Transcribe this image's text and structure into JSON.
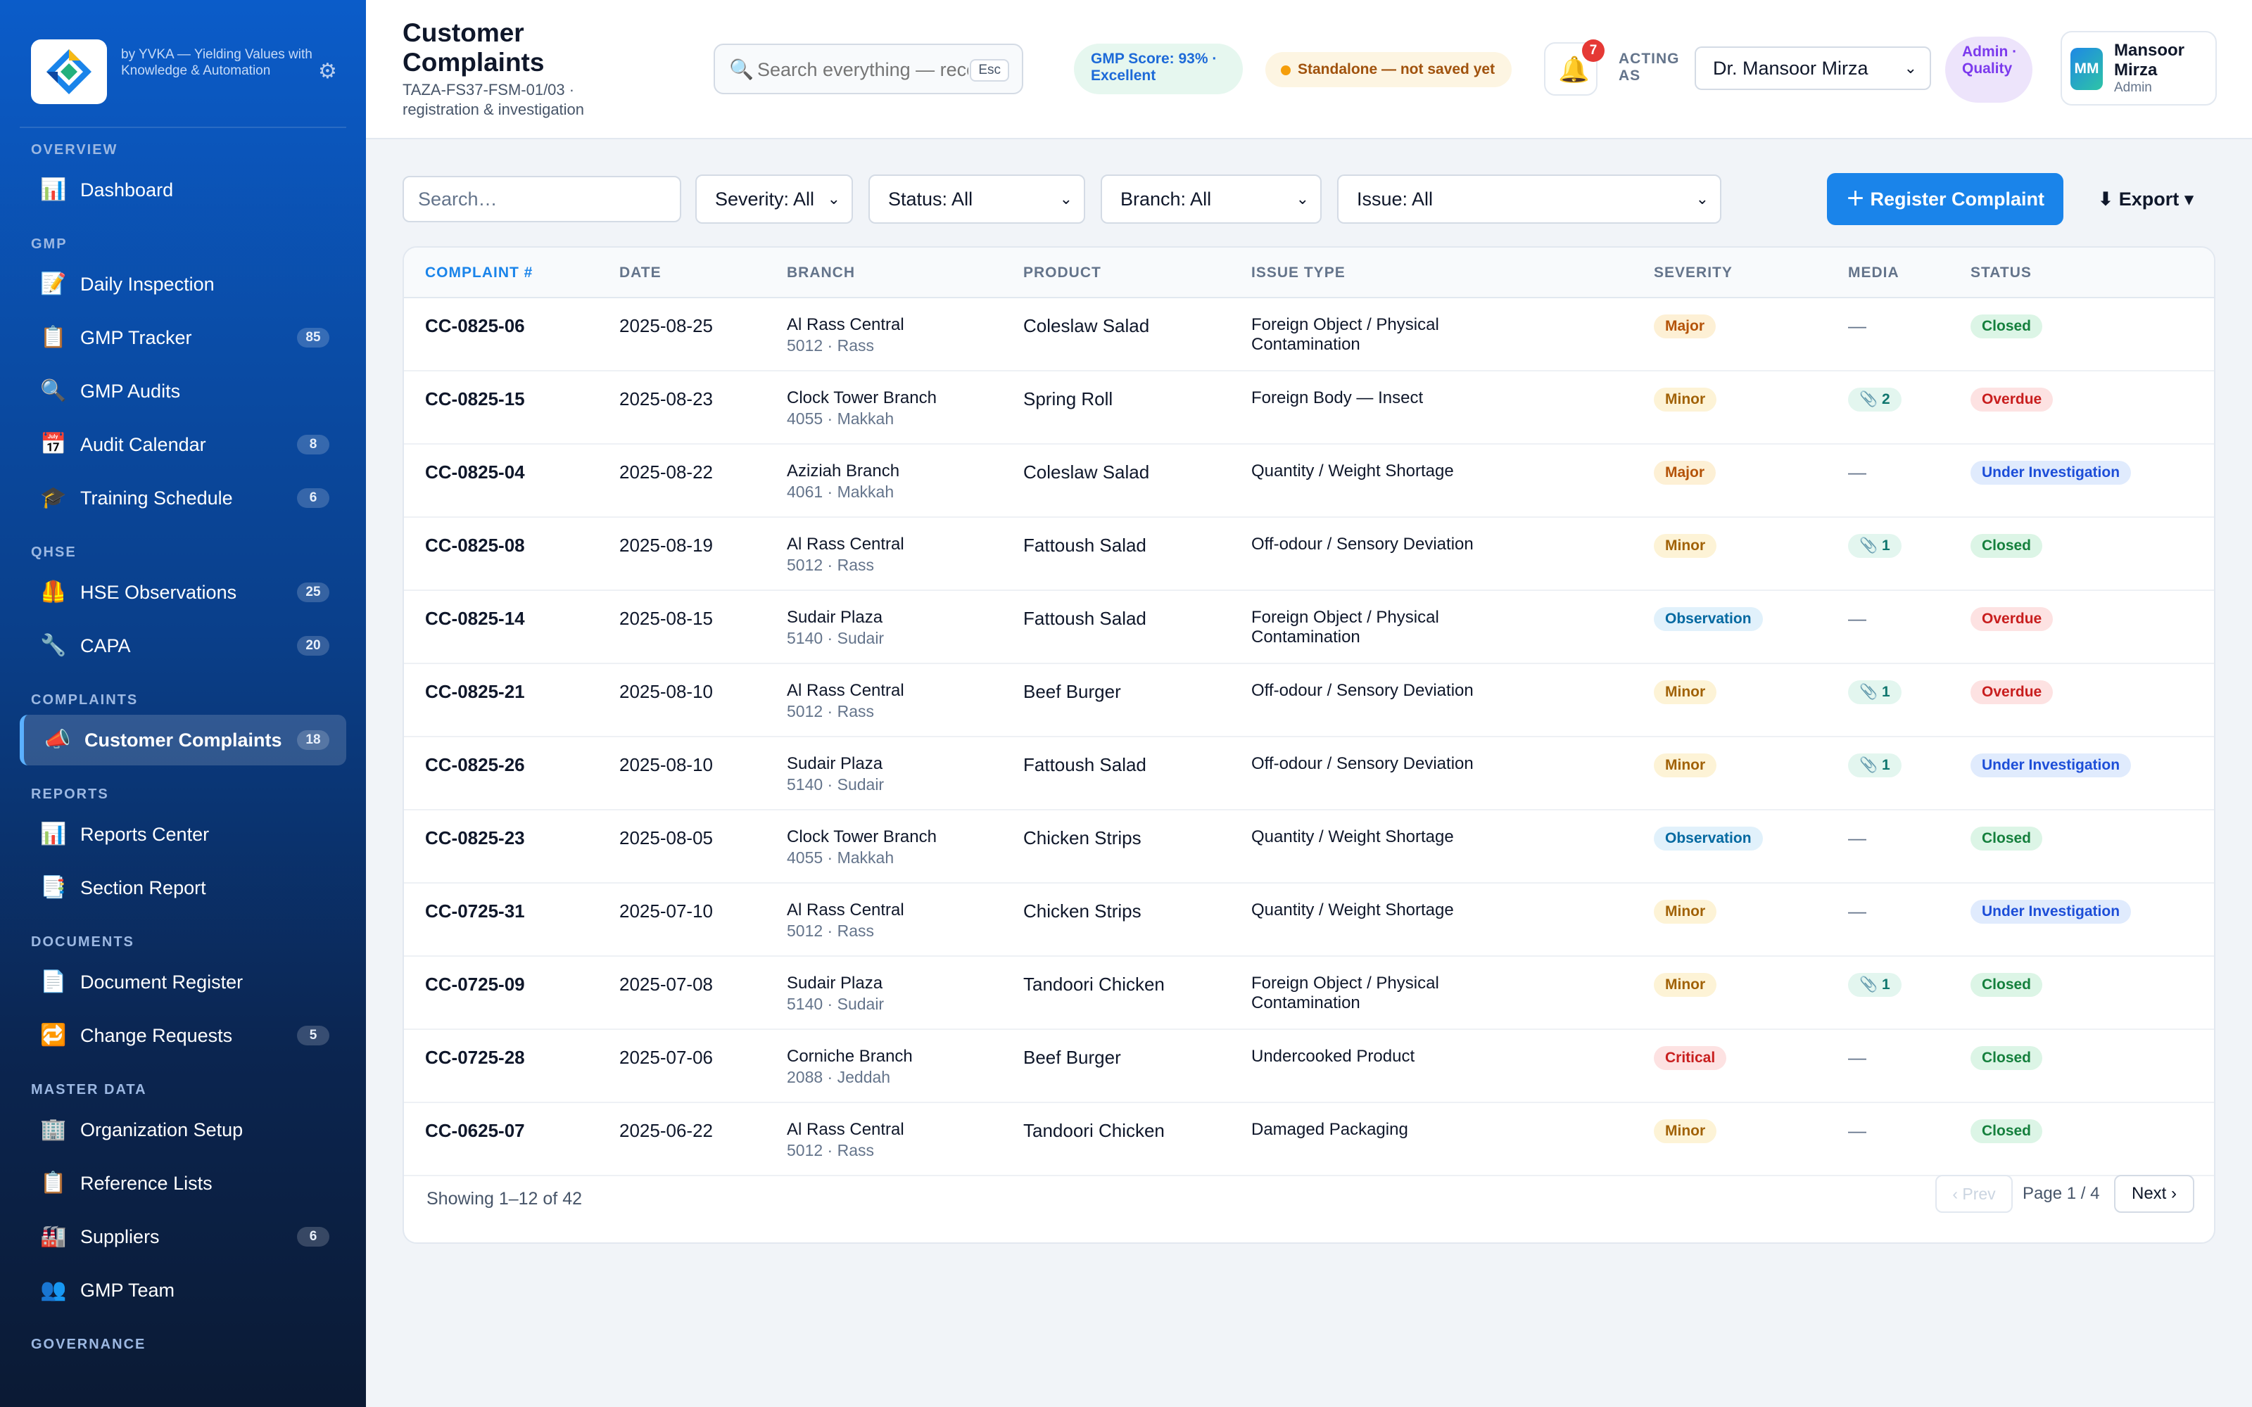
{
  "brand": {
    "tagline": "by YVKA — Yielding Values with Knowledge & Automation",
    "colors": {
      "primary": "#1a84ea",
      "sidebar": "#0b5cc9"
    }
  },
  "sidebar": {
    "sections": [
      {
        "title": "OVERVIEW",
        "items": [
          {
            "icon": "chart-icon",
            "glyph": "📊",
            "label": "Dashboard",
            "badge": ""
          }
        ]
      },
      {
        "title": "GMP",
        "items": [
          {
            "icon": "inspection-icon",
            "glyph": "📝",
            "label": "Daily Inspection",
            "badge": ""
          },
          {
            "icon": "clipboard-icon",
            "glyph": "📋",
            "label": "GMP Tracker",
            "badge": "85"
          },
          {
            "icon": "magnifier-icon",
            "glyph": "🔍",
            "label": "GMP Audits",
            "badge": ""
          },
          {
            "icon": "calendar-icon",
            "glyph": "📅",
            "label": "Audit Calendar",
            "badge": "8"
          },
          {
            "icon": "graduation-cap-icon",
            "glyph": "🎓",
            "label": "Training Schedule",
            "badge": "6"
          }
        ]
      },
      {
        "title": "QHSE",
        "items": [
          {
            "icon": "safety-vest-icon",
            "glyph": "🦺",
            "label": "HSE Observations",
            "badge": "25"
          },
          {
            "icon": "wrench-icon",
            "glyph": "🔧",
            "label": "CAPA",
            "badge": "20"
          }
        ]
      },
      {
        "title": "COMPLAINTS",
        "items": [
          {
            "icon": "megaphone-icon",
            "glyph": "📣",
            "label": "Customer Complaints",
            "badge": "18",
            "active": true
          }
        ]
      },
      {
        "title": "REPORTS",
        "items": [
          {
            "icon": "chart-icon",
            "glyph": "📊",
            "label": "Reports Center",
            "badge": ""
          },
          {
            "icon": "report-icon",
            "glyph": "📑",
            "label": "Section Report",
            "badge": ""
          }
        ]
      },
      {
        "title": "DOCUMENTS",
        "items": [
          {
            "icon": "document-icon",
            "glyph": "📄",
            "label": "Document Register",
            "badge": ""
          },
          {
            "icon": "cycle-icon",
            "glyph": "🔁",
            "label": "Change Requests",
            "badge": "5"
          }
        ]
      },
      {
        "title": "MASTER DATA",
        "items": [
          {
            "icon": "building-icon",
            "glyph": "🏢",
            "label": "Organization Setup",
            "badge": ""
          },
          {
            "icon": "clipboard-icon",
            "glyph": "📋",
            "label": "Reference Lists",
            "badge": ""
          },
          {
            "icon": "factory-icon",
            "glyph": "🏭",
            "label": "Suppliers",
            "badge": "6"
          },
          {
            "icon": "team-icon",
            "glyph": "👥",
            "label": "GMP Team",
            "badge": ""
          }
        ]
      },
      {
        "title": "GOVERNANCE",
        "items": []
      }
    ]
  },
  "header": {
    "title": "Customer Complaints",
    "subtitle": "TAZA-FS37-FSM-01/03 · registration & investigation",
    "search_placeholder": "Search everything — records, SOPs, branches…",
    "search_shortcut": "Esc",
    "gmp_score": "GMP Score: 93% · Excellent",
    "standalone_status": "Standalone — not saved yet",
    "notification_count": "7",
    "acting_as_label": "ACTING AS",
    "acting_as_value": "Dr. Mansoor Mirza",
    "role_badge": "Admin · Quality",
    "user": {
      "initials": "MM",
      "name": "Mansoor Mirza",
      "role": "Admin"
    }
  },
  "toolbar": {
    "search_placeholder": "Search…",
    "filters": [
      "Severity: All",
      "Status: All",
      "Branch: All",
      "Issue: All"
    ],
    "register_label": "＋ Register Complaint",
    "export_label": "⬇ Export ▾"
  },
  "table": {
    "columns": [
      "COMPLAINT #",
      "DATE",
      "BRANCH",
      "PRODUCT",
      "ISSUE TYPE",
      "SEVERITY",
      "MEDIA",
      "STATUS"
    ],
    "rows": [
      {
        "id": "CC-0825-06",
        "date": "2025-08-25",
        "branch": "Al Rass Central",
        "branch_sub": "5012 · Rass",
        "product": "Coleslaw Salad",
        "issue": "Foreign Object / Physical Contamination",
        "severity": "Major",
        "media": "—",
        "status": "Closed"
      },
      {
        "id": "CC-0825-15",
        "date": "2025-08-23",
        "branch": "Clock Tower Branch",
        "branch_sub": "4055 · Makkah",
        "product": "Spring Roll",
        "issue": "Foreign Body — Insect",
        "severity": "Minor",
        "media": "📎 2",
        "status": "Overdue"
      },
      {
        "id": "CC-0825-04",
        "date": "2025-08-22",
        "branch": "Aziziah Branch",
        "branch_sub": "4061 · Makkah",
        "product": "Coleslaw Salad",
        "issue": "Quantity / Weight Shortage",
        "severity": "Major",
        "media": "—",
        "status": "Under Investigation"
      },
      {
        "id": "CC-0825-08",
        "date": "2025-08-19",
        "branch": "Al Rass Central",
        "branch_sub": "5012 · Rass",
        "product": "Fattoush Salad",
        "issue": "Off-odour / Sensory Deviation",
        "severity": "Minor",
        "media": "📎 1",
        "status": "Closed"
      },
      {
        "id": "CC-0825-14",
        "date": "2025-08-15",
        "branch": "Sudair Plaza",
        "branch_sub": "5140 · Sudair",
        "product": "Fattoush Salad",
        "issue": "Foreign Object / Physical Contamination",
        "severity": "Observation",
        "media": "—",
        "status": "Overdue"
      },
      {
        "id": "CC-0825-21",
        "date": "2025-08-10",
        "branch": "Al Rass Central",
        "branch_sub": "5012 · Rass",
        "product": "Beef Burger",
        "issue": "Off-odour / Sensory Deviation",
        "severity": "Minor",
        "media": "📎 1",
        "status": "Overdue"
      },
      {
        "id": "CC-0825-26",
        "date": "2025-08-10",
        "branch": "Sudair Plaza",
        "branch_sub": "5140 · Sudair",
        "product": "Fattoush Salad",
        "issue": "Off-odour / Sensory Deviation",
        "severity": "Minor",
        "media": "📎 1",
        "status": "Under Investigation"
      },
      {
        "id": "CC-0825-23",
        "date": "2025-08-05",
        "branch": "Clock Tower Branch",
        "branch_sub": "4055 · Makkah",
        "product": "Chicken Strips",
        "issue": "Quantity / Weight Shortage",
        "severity": "Observation",
        "media": "—",
        "status": "Closed"
      },
      {
        "id": "CC-0725-31",
        "date": "2025-07-10",
        "branch": "Al Rass Central",
        "branch_sub": "5012 · Rass",
        "product": "Chicken Strips",
        "issue": "Quantity / Weight Shortage",
        "severity": "Minor",
        "media": "—",
        "status": "Under Investigation"
      },
      {
        "id": "CC-0725-09",
        "date": "2025-07-08",
        "branch": "Sudair Plaza",
        "branch_sub": "5140 · Sudair",
        "product": "Tandoori Chicken",
        "issue": "Foreign Object / Physical Contamination",
        "severity": "Minor",
        "media": "📎 1",
        "status": "Closed"
      },
      {
        "id": "CC-0725-28",
        "date": "2025-07-06",
        "branch": "Corniche Branch",
        "branch_sub": "2088 · Jeddah",
        "product": "Beef Burger",
        "issue": "Undercooked Product",
        "severity": "Critical",
        "media": "—",
        "status": "Closed"
      },
      {
        "id": "CC-0625-07",
        "date": "2025-06-22",
        "branch": "Al Rass Central",
        "branch_sub": "5012 · Rass",
        "product": "Tandoori Chicken",
        "issue": "Damaged Packaging",
        "severity": "Minor",
        "media": "—",
        "status": "Closed"
      }
    ],
    "severity_colors": {
      "Major": {
        "bg": "#fdf0d5",
        "fg": "#b45309"
      },
      "Minor": {
        "bg": "#fdf3d6",
        "fg": "#a16207"
      },
      "Observation": {
        "bg": "#e1f1fb",
        "fg": "#0369a1"
      },
      "Critical": {
        "bg": "#fde2e2",
        "fg": "#c81e1e"
      }
    },
    "status_colors": {
      "Closed": {
        "bg": "#dcf5e6",
        "fg": "#15803d"
      },
      "Overdue": {
        "bg": "#fde2e2",
        "fg": "#c81e1e"
      },
      "Under Investigation": {
        "bg": "#e0ebfd",
        "fg": "#1d4ed8"
      }
    },
    "media_color": {
      "bg": "#e3f6ef",
      "fg": "#0f766e"
    },
    "footer": "Showing 1–12 of 42",
    "pagination": {
      "prev": "‹ Prev",
      "page": "Page 1 / 4",
      "next": "Next ›"
    }
  }
}
